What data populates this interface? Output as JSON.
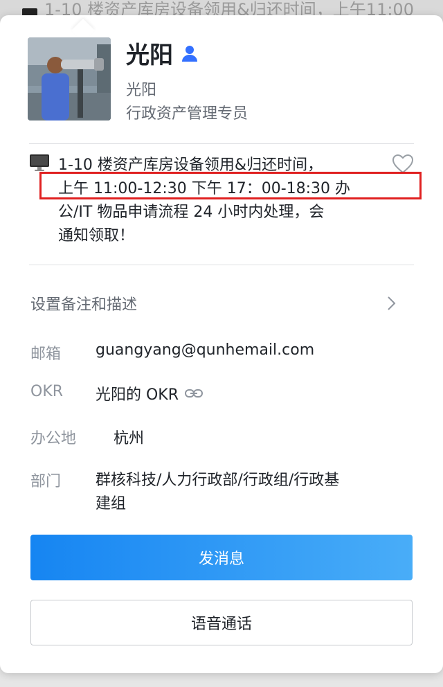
{
  "background": {
    "snippet": "1-10 楼资产库房设备领用&归还时间，上午11:00"
  },
  "profile": {
    "name": "光阳",
    "alias": "光阳",
    "title": "行政资产管理专员",
    "verified_icon": "person-icon"
  },
  "status": {
    "line1": "1-10 楼资产库房设备领用&归还时间，",
    "line2": "上午 11:00-12:30 下午 17：00-18:30 办",
    "line3": "公/IT 物品申请流程 24 小时内处理，会",
    "line4": "通知领取！",
    "icon": "monitor-icon",
    "like_icon": "heart-icon"
  },
  "remark": {
    "label": "设置备注和描述",
    "icon": "chevron-right-icon"
  },
  "fields": {
    "email": {
      "label": "邮箱",
      "value": "guangyang@qunhemail.com"
    },
    "okr": {
      "label": "OKR",
      "value": "光阳的 OKR",
      "icon": "link-icon"
    },
    "office": {
      "label": "办公地",
      "value": "杭州"
    },
    "dept": {
      "label": "部门",
      "value_line1": "群核科技/人力行政部/行政组/行政基",
      "value_line2": "建组"
    }
  },
  "actions": {
    "message_label": "发消息",
    "call_label": "语音通话"
  },
  "colors": {
    "accent": "#1685f2",
    "highlight": "#e02020",
    "text": "#1f2329",
    "muted": "#646a73"
  }
}
